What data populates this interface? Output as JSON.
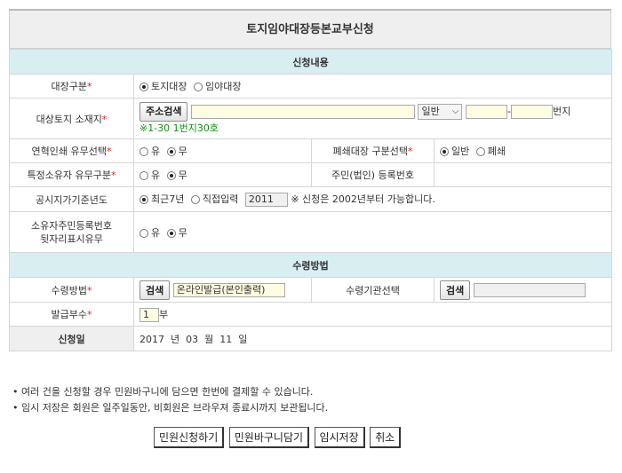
{
  "page_title": "토지임야대장등본교부신청",
  "section1_title": "신청내용",
  "section2_title": "수령방법",
  "required_mark": "*",
  "ledger_type": {
    "label": "대장구분",
    "options": [
      "토지대장",
      "임야대장"
    ],
    "selected": "토지대장"
  },
  "location": {
    "label": "대상토지 소재지",
    "search_button": "주소검색",
    "address_value": "",
    "select_value": "일반",
    "lot_main": "",
    "lot_sep": "-",
    "lot_sub": "",
    "lot_suffix": "번지",
    "hint": "※1-30 1번지30호"
  },
  "history_print": {
    "label": "연혁인쇄 유무선택",
    "options": [
      "유",
      "무"
    ],
    "selected": "무"
  },
  "closed_ledger": {
    "label": "폐쇄대장 구분선택",
    "options": [
      "일반",
      "폐쇄"
    ],
    "selected": "일반"
  },
  "owner_special": {
    "label": "특정소유자 유무구분",
    "options": [
      "유",
      "무"
    ],
    "selected": "무"
  },
  "resident_no": {
    "label": "주민(법인) 등록번호",
    "value": ""
  },
  "land_price_year": {
    "label": "공시지가기준년도",
    "options": [
      "최근7년",
      "직접입력"
    ],
    "selected": "최근7년",
    "input_value": "2011",
    "note": "※ 신청은 2002년부터 가능합니다."
  },
  "owner_rrn_display": {
    "label_line1": "소유자주민등록번호",
    "label_line2": "뒷자리표시유무",
    "options": [
      "유",
      "무"
    ],
    "selected": "무"
  },
  "receive_method": {
    "label": "수령방법",
    "search_button": "검색",
    "value": "온라인발급(본인출력)"
  },
  "receive_agency": {
    "label": "수령기관선택",
    "search_button": "검색",
    "value": ""
  },
  "copies": {
    "label": "발급부수",
    "value": "1",
    "unit": "부"
  },
  "apply_date": {
    "label": "신청일",
    "year": "2017",
    "year_unit": "년",
    "month": "03",
    "month_unit": "월",
    "day": "11",
    "day_unit": "일"
  },
  "notes": [
    "• 여러 건을 신청할 경우 민원바구니에 담으면 한번에 결제할 수 있습니다.",
    "• 임시 저장은 회원은 일주일동안, 비회원은 브라우져 종료시까지 보관됩니다."
  ],
  "buttons": {
    "apply": "민원신청하기",
    "basket": "민원바구니담기",
    "temp_save": "임시저장",
    "cancel": "취소"
  }
}
